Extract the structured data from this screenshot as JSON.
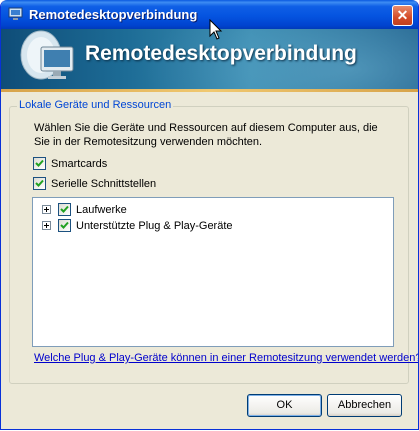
{
  "window": {
    "title": "Remotedesktopverbindung",
    "close_glyph": "✕"
  },
  "banner": {
    "heading": "Remotedesktopverbindung",
    "icon": "remote-desktop-computer-icon"
  },
  "group": {
    "legend": "Lokale Geräte und Ressourcen",
    "description": "Wählen Sie die Geräte und Ressourcen auf diesem Computer aus, die Sie in der Remotesitzung verwenden möchten.",
    "options": [
      {
        "label": "Smartcards",
        "checked": true
      },
      {
        "label": "Serielle Schnittstellen",
        "checked": true
      }
    ],
    "tree": [
      {
        "label": "Laufwerke",
        "checked": true,
        "expanded": false
      },
      {
        "label": "Unterstützte Plug & Play-Geräte",
        "checked": true,
        "expanded": false
      }
    ]
  },
  "help_link": "Welche Plug & Play-Geräte können in einer Remotesitzung verwendet werden?",
  "buttons": {
    "ok": "OK",
    "cancel": "Abbrechen"
  },
  "colors": {
    "titlebar": "#0554e0",
    "legend": "#0046d5",
    "link": "#0000cc",
    "dialog_bg": "#ece9d8"
  }
}
